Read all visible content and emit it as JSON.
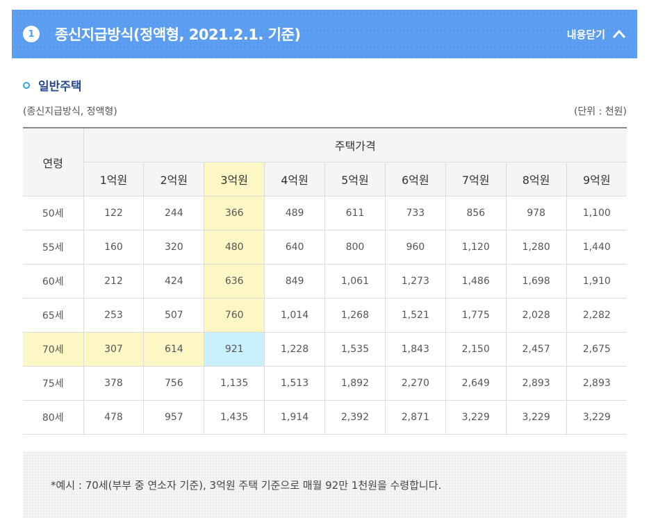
{
  "header": {
    "number": "1",
    "title": "종신지급방식(정액형, 2021.2.1. 기준)",
    "toggle_label": "내용닫기"
  },
  "section": {
    "title": "일반주택",
    "caption_left": "(종신지급방식, 정액형)",
    "caption_right": "(단위 : 천원)"
  },
  "table": {
    "age_header": "연령",
    "price_header": "주택가격",
    "columns": [
      "1억원",
      "2억원",
      "3억원",
      "4억원",
      "5억원",
      "6억원",
      "7억원",
      "8억원",
      "9억원"
    ],
    "rows": [
      {
        "age": "50세",
        "values": [
          "122",
          "244",
          "366",
          "489",
          "611",
          "733",
          "856",
          "978",
          "1,100"
        ]
      },
      {
        "age": "55세",
        "values": [
          "160",
          "320",
          "480",
          "640",
          "800",
          "960",
          "1,120",
          "1,280",
          "1,440"
        ]
      },
      {
        "age": "60세",
        "values": [
          "212",
          "424",
          "636",
          "849",
          "1,061",
          "1,273",
          "1,486",
          "1,698",
          "1,910"
        ]
      },
      {
        "age": "65세",
        "values": [
          "253",
          "507",
          "760",
          "1,014",
          "1,268",
          "1,521",
          "1,775",
          "2,028",
          "2,282"
        ]
      },
      {
        "age": "70세",
        "values": [
          "307",
          "614",
          "921",
          "1,228",
          "1,535",
          "1,843",
          "2,150",
          "2,457",
          "2,675"
        ]
      },
      {
        "age": "75세",
        "values": [
          "378",
          "756",
          "1,135",
          "1,513",
          "1,892",
          "2,270",
          "2,649",
          "2,893",
          "2,893"
        ]
      },
      {
        "age": "80세",
        "values": [
          "478",
          "957",
          "1,435",
          "1,914",
          "2,392",
          "2,871",
          "3,229",
          "3,229",
          "3,229"
        ]
      }
    ]
  },
  "note": "*예시 : 70세(부부 중 연소자 기준), 3억원 주택 기준으로 매월 92만 1천원을 수령합니다.",
  "colors": {
    "header_bg": "#5a9cf0",
    "highlight_column": "#fcf7c5",
    "highlight_cell": "#c9f0fb"
  }
}
